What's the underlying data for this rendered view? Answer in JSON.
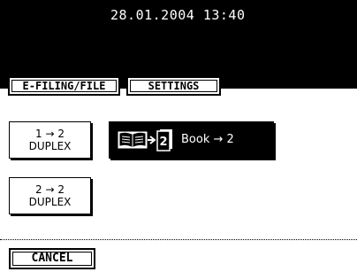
{
  "header": {
    "datetime": "28.01.2004 13:40"
  },
  "tabs": {
    "efiling_label": "E-FILING/FILE",
    "settings_label": "SETTINGS"
  },
  "duplex": {
    "option1_line1": "1 → 2",
    "option1_line2": "DUPLEX",
    "option2_line1": "2 → 2",
    "option2_line2": "DUPLEX",
    "book_label": "Book → 2",
    "book_page_num": "2"
  },
  "footer": {
    "cancel_label": "CANCEL"
  },
  "colors": {
    "background": "#ffffff",
    "header": "#000000",
    "selected": "#000000"
  },
  "icons": [
    "open-book-icon",
    "arrow-right-icon",
    "two-sided-page-icon"
  ]
}
